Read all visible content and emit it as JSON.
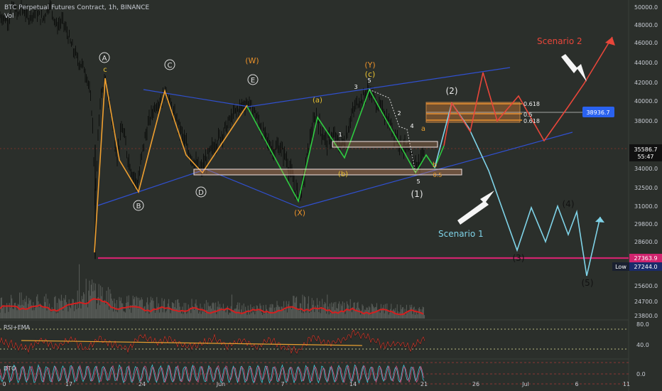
{
  "header": {
    "title": "BTC Perpetual Futures Contract, 1h, BINANCE",
    "vol_label": "Vol"
  },
  "indicators": {
    "rsi_label": "RSI+EMA",
    "dto_label": "DTO",
    "rsi_ticks": [
      "80.0",
      "40.0"
    ],
    "dto_ticks": [
      "0.0"
    ]
  },
  "price_labels": {
    "current": "35586.7",
    "countdown": "55:47",
    "marker": "38936.7",
    "line_level": "27363.9",
    "low_label": "Low",
    "low_value": "27244.0"
  },
  "colors": {
    "background": "#2b2f2b",
    "candle": "#0d0f0d",
    "orange_wave": "#f0a030",
    "green_wave": "#2ecc40",
    "blue_line": "#3050d0",
    "cyan_path": "#7fd3e8",
    "red_path": "#e8463a",
    "magenta_line": "#d0246e"
  },
  "chart_data": {
    "type": "candlestick",
    "symbol": "BTC Perpetual Futures Contract",
    "timeframe": "1h",
    "exchange": "BINANCE",
    "x_tick_labels": [
      "0",
      "17",
      "24",
      "Jun",
      "7",
      "14",
      "21",
      "26",
      "Jul",
      "6",
      "11"
    ],
    "y_tick_labels": [
      "50000.0",
      "48000.0",
      "46000.0",
      "44000.0",
      "42000.0",
      "40000.0",
      "38000.0",
      "34000.0",
      "32500.0",
      "31000.0",
      "29800.0",
      "28600.0",
      "25600.0",
      "24700.0",
      "23800.0"
    ],
    "ylim": [
      23800,
      50000
    ],
    "price_path": [
      {
        "x": 0,
        "y": 49000
      },
      {
        "x": 12,
        "y": 48500
      },
      {
        "x": 18,
        "y": 50200
      },
      {
        "x": 25,
        "y": 49000
      },
      {
        "x": 30,
        "y": 50000
      },
      {
        "x": 40,
        "y": 48800
      },
      {
        "x": 50,
        "y": 49500
      },
      {
        "x": 60,
        "y": 48600
      },
      {
        "x": 70,
        "y": 50400
      },
      {
        "x": 80,
        "y": 47800
      },
      {
        "x": 88,
        "y": 48500
      },
      {
        "x": 95,
        "y": 47000
      },
      {
        "x": 100,
        "y": 45800
      },
      {
        "x": 110,
        "y": 44200
      },
      {
        "x": 118,
        "y": 43500
      },
      {
        "x": 124,
        "y": 42200
      },
      {
        "x": 130,
        "y": 38500
      },
      {
        "x": 134,
        "y": 31000
      },
      {
        "x": 137,
        "y": 35000
      },
      {
        "x": 141,
        "y": 40200
      },
      {
        "x": 148,
        "y": 42100
      },
      {
        "x": 156,
        "y": 39000
      },
      {
        "x": 165,
        "y": 35000
      },
      {
        "x": 172,
        "y": 37500
      },
      {
        "x": 180,
        "y": 35000
      },
      {
        "x": 187,
        "y": 33500
      },
      {
        "x": 194,
        "y": 32700
      },
      {
        "x": 202,
        "y": 36000
      },
      {
        "x": 210,
        "y": 38000
      },
      {
        "x": 218,
        "y": 39500
      },
      {
        "x": 226,
        "y": 40000
      },
      {
        "x": 234,
        "y": 41200
      },
      {
        "x": 242,
        "y": 39000
      },
      {
        "x": 250,
        "y": 38000
      },
      {
        "x": 258,
        "y": 36500
      },
      {
        "x": 266,
        "y": 35400
      },
      {
        "x": 276,
        "y": 34300
      },
      {
        "x": 283,
        "y": 33800
      },
      {
        "x": 292,
        "y": 34900
      },
      {
        "x": 305,
        "y": 36300
      },
      {
        "x": 318,
        "y": 37400
      },
      {
        "x": 330,
        "y": 38800
      },
      {
        "x": 342,
        "y": 39600
      },
      {
        "x": 350,
        "y": 39800
      },
      {
        "x": 358,
        "y": 39000
      },
      {
        "x": 366,
        "y": 37700
      },
      {
        "x": 374,
        "y": 36500
      },
      {
        "x": 384,
        "y": 35600
      },
      {
        "x": 394,
        "y": 35800
      },
      {
        "x": 402,
        "y": 35000
      },
      {
        "x": 410,
        "y": 33600
      },
      {
        "x": 416,
        "y": 32400
      },
      {
        "x": 422,
        "y": 31800
      },
      {
        "x": 428,
        "y": 33200
      },
      {
        "x": 434,
        "y": 35600
      },
      {
        "x": 440,
        "y": 37500
      },
      {
        "x": 446,
        "y": 38600
      },
      {
        "x": 452,
        "y": 37200
      },
      {
        "x": 460,
        "y": 36200
      },
      {
        "x": 470,
        "y": 36700
      },
      {
        "x": 478,
        "y": 35900
      },
      {
        "x": 486,
        "y": 36400
      },
      {
        "x": 494,
        "y": 38300
      },
      {
        "x": 502,
        "y": 39800
      },
      {
        "x": 510,
        "y": 40200
      },
      {
        "x": 518,
        "y": 41200
      },
      {
        "x": 524,
        "y": 40600
      },
      {
        "x": 532,
        "y": 39600
      },
      {
        "x": 540,
        "y": 38900
      },
      {
        "x": 548,
        "y": 37900
      },
      {
        "x": 556,
        "y": 36900
      },
      {
        "x": 564,
        "y": 36100
      },
      {
        "x": 572,
        "y": 35600
      },
      {
        "x": 580,
        "y": 34900
      },
      {
        "x": 588,
        "y": 34200
      },
      {
        "x": 594,
        "y": 35000
      },
      {
        "x": 598,
        "y": 35600
      }
    ],
    "volume_profile": [
      {
        "x": 0,
        "y": 0.55
      },
      {
        "x": 40,
        "y": 0.6
      },
      {
        "x": 80,
        "y": 0.5
      },
      {
        "x": 120,
        "y": 0.9
      },
      {
        "x": 134,
        "y": 1.0
      },
      {
        "x": 160,
        "y": 0.6
      },
      {
        "x": 200,
        "y": 0.5
      },
      {
        "x": 260,
        "y": 0.45
      },
      {
        "x": 320,
        "y": 0.4
      },
      {
        "x": 380,
        "y": 0.35
      },
      {
        "x": 420,
        "y": 0.55
      },
      {
        "x": 470,
        "y": 0.4
      },
      {
        "x": 530,
        "y": 0.35
      },
      {
        "x": 598,
        "y": 0.3
      }
    ],
    "rsi_series": [
      {
        "x": 0,
        "y": 55
      },
      {
        "x": 20,
        "y": 48
      },
      {
        "x": 40,
        "y": 40
      },
      {
        "x": 60,
        "y": 58
      },
      {
        "x": 80,
        "y": 44
      },
      {
        "x": 100,
        "y": 60
      },
      {
        "x": 120,
        "y": 38
      },
      {
        "x": 140,
        "y": 62
      },
      {
        "x": 160,
        "y": 48
      },
      {
        "x": 180,
        "y": 40
      },
      {
        "x": 200,
        "y": 66
      },
      {
        "x": 220,
        "y": 52
      },
      {
        "x": 240,
        "y": 60
      },
      {
        "x": 260,
        "y": 44
      },
      {
        "x": 280,
        "y": 48
      },
      {
        "x": 300,
        "y": 62
      },
      {
        "x": 320,
        "y": 46
      },
      {
        "x": 340,
        "y": 58
      },
      {
        "x": 360,
        "y": 44
      },
      {
        "x": 380,
        "y": 58
      },
      {
        "x": 400,
        "y": 42
      },
      {
        "x": 420,
        "y": 36
      },
      {
        "x": 440,
        "y": 64
      },
      {
        "x": 460,
        "y": 50
      },
      {
        "x": 480,
        "y": 56
      },
      {
        "x": 500,
        "y": 72
      },
      {
        "x": 520,
        "y": 62
      },
      {
        "x": 540,
        "y": 46
      },
      {
        "x": 560,
        "y": 50
      },
      {
        "x": 580,
        "y": 42
      },
      {
        "x": 598,
        "y": 60
      }
    ],
    "horizontal_levels": [
      {
        "label": "27363.9",
        "y": 27363.9,
        "color": "#d0246e"
      },
      {
        "label": "0.618",
        "y": 39300
      },
      {
        "label": "0.5",
        "y": 38600
      },
      {
        "label": "0.618",
        "y": 38100
      }
    ],
    "wave_labels": {
      "circled": [
        "A",
        "B",
        "C",
        "D",
        "E"
      ],
      "orange": [
        "(W)",
        "(Y)",
        "(X)",
        "(c)",
        "(b)",
        "(a)"
      ],
      "numbers": [
        "1",
        "2",
        "3",
        "4",
        "5"
      ],
      "projection": [
        "(1)",
        "(2)",
        "(3)",
        "(4)",
        "(5)"
      ],
      "minor": [
        "a",
        "b",
        "c",
        "5",
        "0.5"
      ]
    },
    "annotations": [
      "Scenario  1",
      "Scenario  2"
    ]
  }
}
